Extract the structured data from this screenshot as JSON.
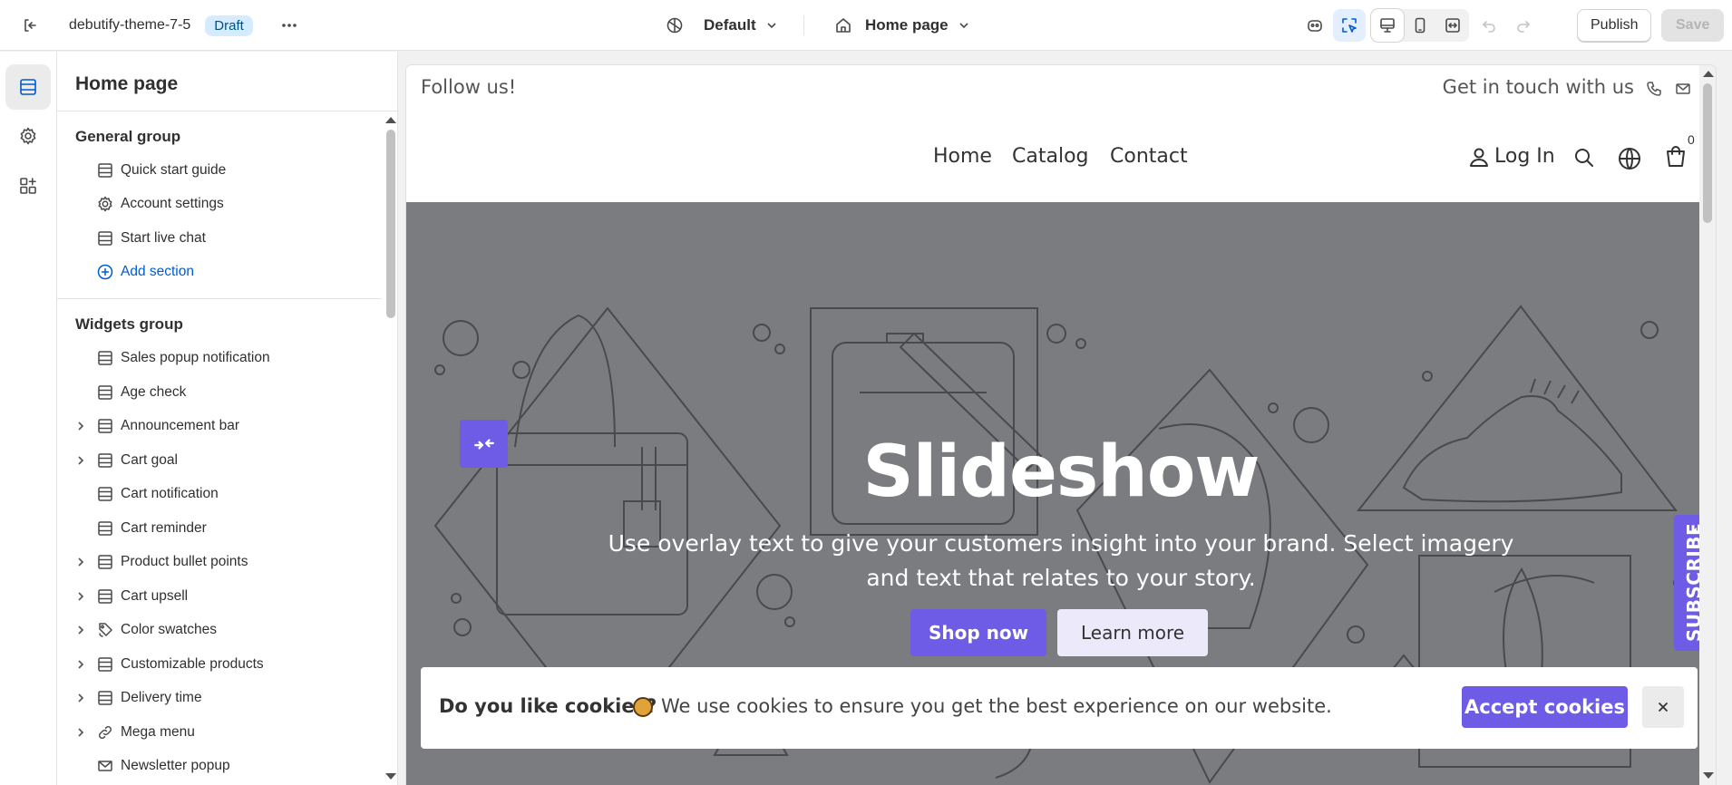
{
  "topbar": {
    "theme_name": "debutify-theme-7-5",
    "status_badge": "Draft",
    "theme_selector": "Default",
    "page_selector": "Home page",
    "publish_label": "Publish",
    "save_label": "Save"
  },
  "panel": {
    "title": "Home page",
    "general_group": {
      "title": "General group",
      "items": [
        {
          "label": "Quick start guide",
          "icon": "section-icon"
        },
        {
          "label": "Account settings",
          "icon": "gear-icon"
        },
        {
          "label": "Start live chat",
          "icon": "section-icon"
        },
        {
          "label": "Add section",
          "icon": "plus-circle-icon"
        }
      ]
    },
    "widgets_group": {
      "title": "Widgets group",
      "items": [
        {
          "label": "Sales popup notification",
          "expandable": false,
          "icon": "section-icon"
        },
        {
          "label": "Age check",
          "expandable": false,
          "icon": "section-icon"
        },
        {
          "label": "Announcement bar",
          "expandable": true,
          "icon": "section-icon"
        },
        {
          "label": "Cart goal",
          "expandable": true,
          "icon": "section-icon"
        },
        {
          "label": "Cart notification",
          "expandable": false,
          "icon": "section-icon"
        },
        {
          "label": "Cart reminder",
          "expandable": false,
          "icon": "section-icon"
        },
        {
          "label": "Product bullet points",
          "expandable": true,
          "icon": "section-icon"
        },
        {
          "label": "Cart upsell",
          "expandable": true,
          "icon": "section-icon"
        },
        {
          "label": "Color swatches",
          "expandable": true,
          "icon": "swatch-icon"
        },
        {
          "label": "Customizable products",
          "expandable": true,
          "icon": "section-icon"
        },
        {
          "label": "Delivery time",
          "expandable": true,
          "icon": "section-icon"
        },
        {
          "label": "Mega menu",
          "expandable": true,
          "icon": "link-icon"
        },
        {
          "label": "Newsletter popup",
          "expandable": false,
          "icon": "mail-icon"
        }
      ]
    }
  },
  "preview": {
    "announcement": {
      "left_text": "Follow us!",
      "right_text": "Get in touch with us"
    },
    "nav": {
      "links": [
        "Home",
        "Catalog",
        "Contact"
      ],
      "login": "Log In",
      "cart_count": "0"
    },
    "hero": {
      "title": "Slideshow",
      "subtitle": "Use overlay text to give your customers insight into your brand. Select imagery and text that relates to your story.",
      "primary_button": "Shop now",
      "secondary_button": "Learn more",
      "subscribe_tab": "SUBSCRIBE"
    },
    "cookie_banner": {
      "question": "Do you like cookies?",
      "message": "We use cookies to ensure you get the best experience on our website.",
      "accept": "Accept cookies"
    }
  },
  "colors": {
    "accent": "#6e5ce6",
    "hero_bg": "#7b7c80",
    "link_blue": "#005bd3",
    "badge_bg": "#d5ebff"
  }
}
